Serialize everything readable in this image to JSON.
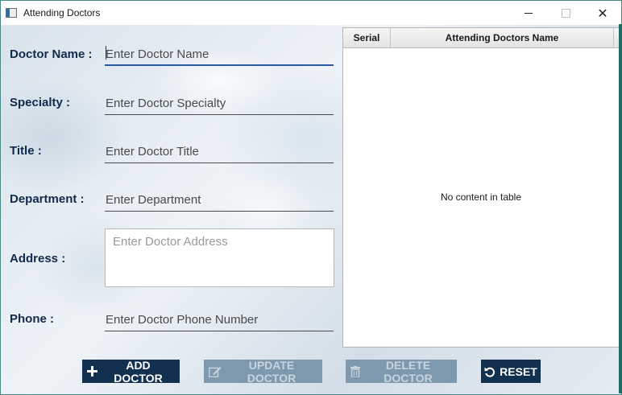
{
  "window": {
    "title": "Attending Doctors",
    "controls": {
      "minimize": "minimize",
      "maximize": "maximize",
      "close": "✕"
    }
  },
  "form": {
    "fields": [
      {
        "label": "Doctor Name :",
        "placeholder": "Enter Doctor Name"
      },
      {
        "label": "Specialty :",
        "placeholder": "Enter Doctor Specialty"
      },
      {
        "label": "Title :",
        "placeholder": "Enter Doctor Title"
      },
      {
        "label": "Department :",
        "placeholder": "Enter Department"
      },
      {
        "label": "Address :",
        "placeholder": "Enter Doctor Address"
      },
      {
        "label": "Phone :",
        "placeholder": "Enter Doctor Phone Number"
      }
    ]
  },
  "table": {
    "columns": [
      "Serial",
      "Attending Doctors Name"
    ],
    "rows": [],
    "empty_message": "No content in table"
  },
  "buttons": {
    "add": {
      "label": "ADD DOCTOR",
      "icon": "plus-icon",
      "enabled": true
    },
    "update": {
      "label": "UPDATE DOCTOR",
      "icon": "edit-icon",
      "enabled": false
    },
    "delete": {
      "label": "DELETE DOCTOR",
      "icon": "trash-icon",
      "enabled": false
    },
    "reset": {
      "label": "RESET",
      "icon": "undo-icon",
      "enabled": true
    }
  },
  "colors": {
    "label_text": "#102a4c",
    "button_bg": "#12304f",
    "button_disabled_bg": "#7e98ad",
    "focus_underline": "#2c5aa0"
  }
}
